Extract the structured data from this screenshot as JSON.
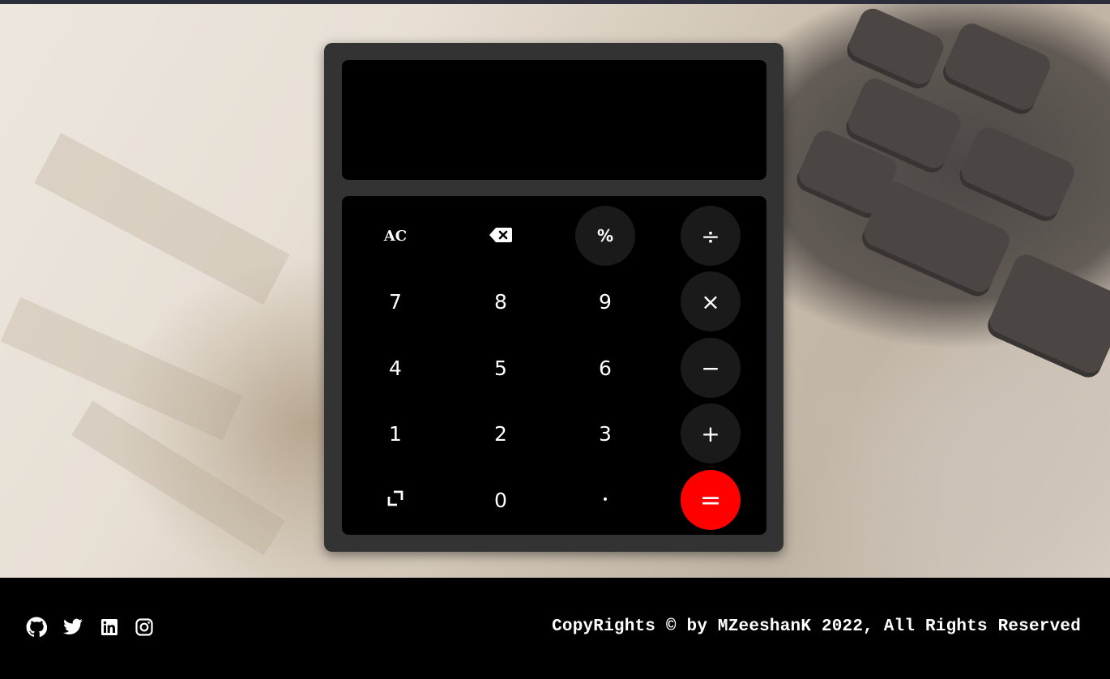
{
  "display": {
    "value": ""
  },
  "keypad": {
    "row1": {
      "clear": "AC",
      "backspace_icon": "backspace-icon",
      "percent": "%",
      "divide": "÷"
    },
    "row2": [
      "7",
      "8",
      "9",
      "×"
    ],
    "row3": [
      "4",
      "5",
      "6",
      "−"
    ],
    "row4": [
      "1",
      "2",
      "3",
      "+"
    ],
    "row5": {
      "toggle_icon": "corner-icon",
      "zero": "0",
      "decimal": "•",
      "equals": "="
    }
  },
  "footer": {
    "social_icons": [
      "github-icon",
      "twitter-icon",
      "linkedin-icon",
      "instagram-icon"
    ],
    "copyright": "CopyRights © by MZeeshanK 2022, All Rights Reserved"
  },
  "colors": {
    "calculator_body": "#333333",
    "panel": "#000000",
    "operator_button": "#1a1a1a",
    "equals_button": "#fe0000",
    "footer_bg": "#000000"
  }
}
